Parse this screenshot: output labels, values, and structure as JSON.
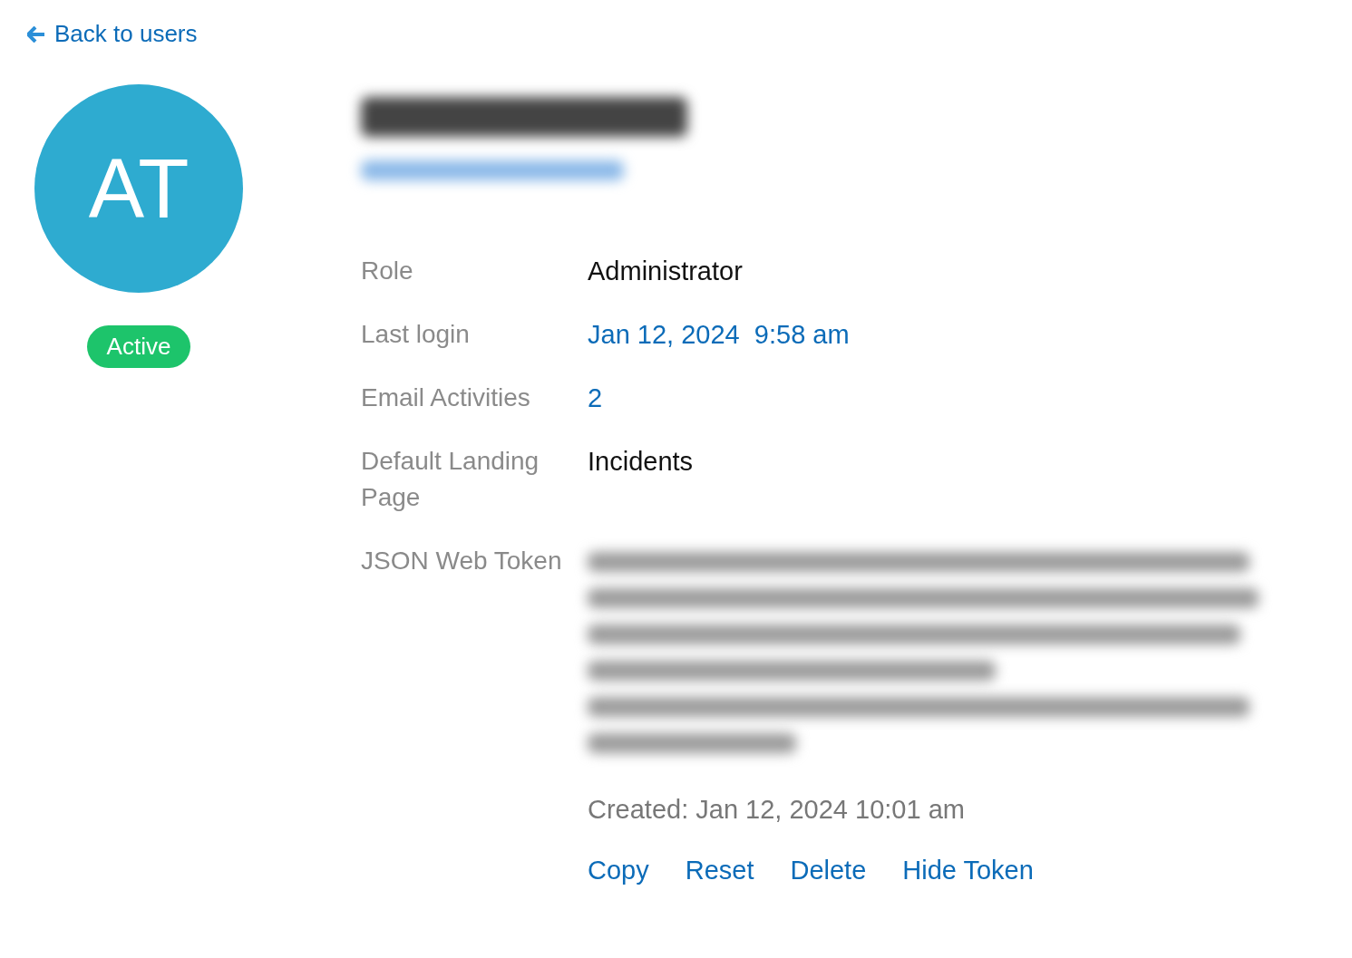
{
  "back_link": "Back to users",
  "avatar": {
    "initials": "AT"
  },
  "status": {
    "label": "Active",
    "color": "#1dc46b"
  },
  "details": [
    {
      "label": "Role",
      "value": "Administrator",
      "kind": "text"
    },
    {
      "label": "Last login",
      "value": "Jan 12, 2024  9:58 am",
      "kind": "link"
    },
    {
      "label": "Email Activities",
      "value": "2",
      "kind": "link"
    },
    {
      "label": "Default Landing Page",
      "value": "Incidents",
      "kind": "text"
    },
    {
      "label": "JSON Web Token",
      "kind": "token"
    }
  ],
  "token": {
    "created": "Created: Jan 12, 2024 10:01 am",
    "actions": [
      "Copy",
      "Reset",
      "Delete",
      "Hide Token"
    ]
  }
}
